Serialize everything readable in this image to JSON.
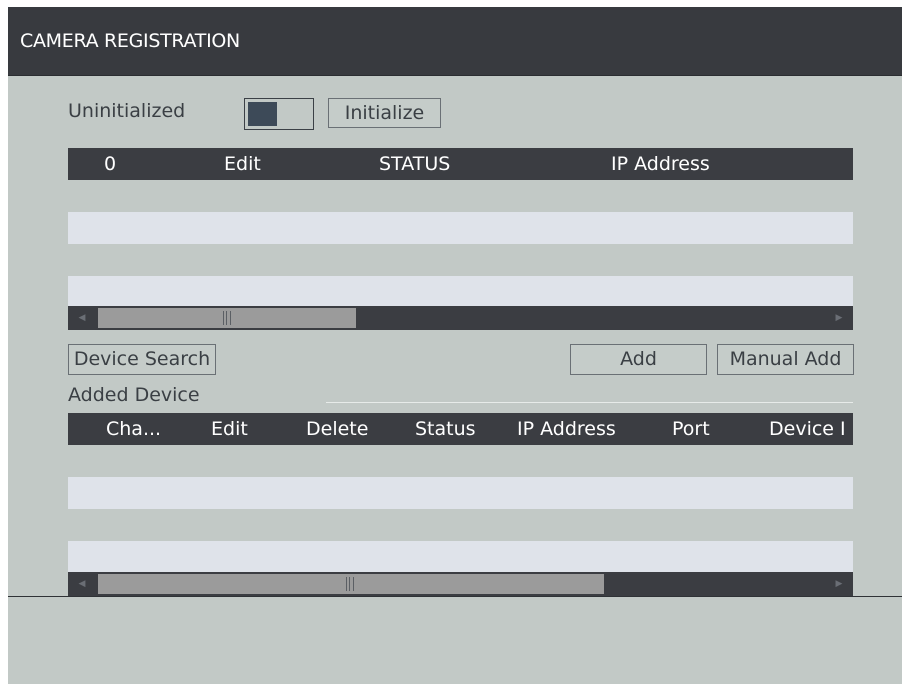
{
  "window": {
    "title": "CAMERA REGISTRATION"
  },
  "uninitialized": {
    "label": "Uninitialized",
    "toggle_state": "off",
    "initialize_button": "Initialize"
  },
  "search_table": {
    "columns": [
      "0",
      "Edit",
      "STATUS",
      "IP Address"
    ],
    "rows": [],
    "scroll_position": 0.0
  },
  "actions": {
    "device_search": "Device Search",
    "add": "Add",
    "manual_add": "Manual Add"
  },
  "added_device": {
    "title": "Added Device",
    "columns": [
      "Cha...",
      "Edit",
      "Delete",
      "Status",
      "IP Address",
      "Port",
      "Device I"
    ],
    "rows": [],
    "scroll_position": 0.0
  },
  "colors": {
    "panel_bg": "#c2c9c6",
    "titlebar_bg": "#383a3f",
    "header_bg": "#3b3d42",
    "row_alt": "#dfe3ea",
    "scroll_thumb": "#9b9b9b"
  },
  "icons": {
    "toggle_knob": "toggle-switch-knob",
    "scroll_left": "triangle-left",
    "scroll_right": "triangle-right",
    "scroll_grip": "grip-lines"
  }
}
